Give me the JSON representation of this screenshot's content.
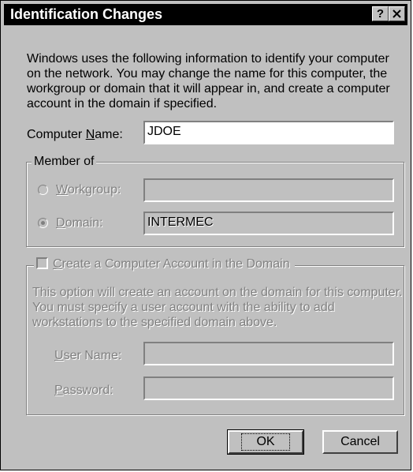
{
  "window": {
    "title": "Identification Changes",
    "help_button": "?",
    "close_button": "✕"
  },
  "intro_text": "Windows uses the following information to identify your computer on the network.  You may change the name for this computer, the workgroup or domain that it will appear in, and create a computer account in the domain if specified.",
  "computer_name": {
    "label_pre": "Computer ",
    "label_mnemonic": "N",
    "label_post": "ame:",
    "value": "JDOE"
  },
  "member_of": {
    "label": "Member of",
    "workgroup": {
      "label_mnemonic": "W",
      "label_post": "orkgroup:",
      "value": "",
      "selected": false,
      "enabled": false
    },
    "domain": {
      "label_mnemonic": "D",
      "label_post": "omain:",
      "value": "INTERMEC",
      "selected": true,
      "enabled": false
    }
  },
  "create_account": {
    "label_mnemonic": "C",
    "label_post": "reate a Computer Account in the Domain",
    "checked": false,
    "description": "This option will create an account on the domain for this computer.  You must specify a user account with the ability to add workstations to the specified domain above.",
    "user_name": {
      "label_mnemonic": "U",
      "label_post": "ser Name:",
      "value": ""
    },
    "password": {
      "label_mnemonic": "P",
      "label_post": "assword:",
      "value": ""
    }
  },
  "buttons": {
    "ok": "OK",
    "cancel": "Cancel"
  },
  "colors": {
    "face": "#c0c0c0",
    "disabled_text": "#808080",
    "titlebar": "#000000"
  }
}
